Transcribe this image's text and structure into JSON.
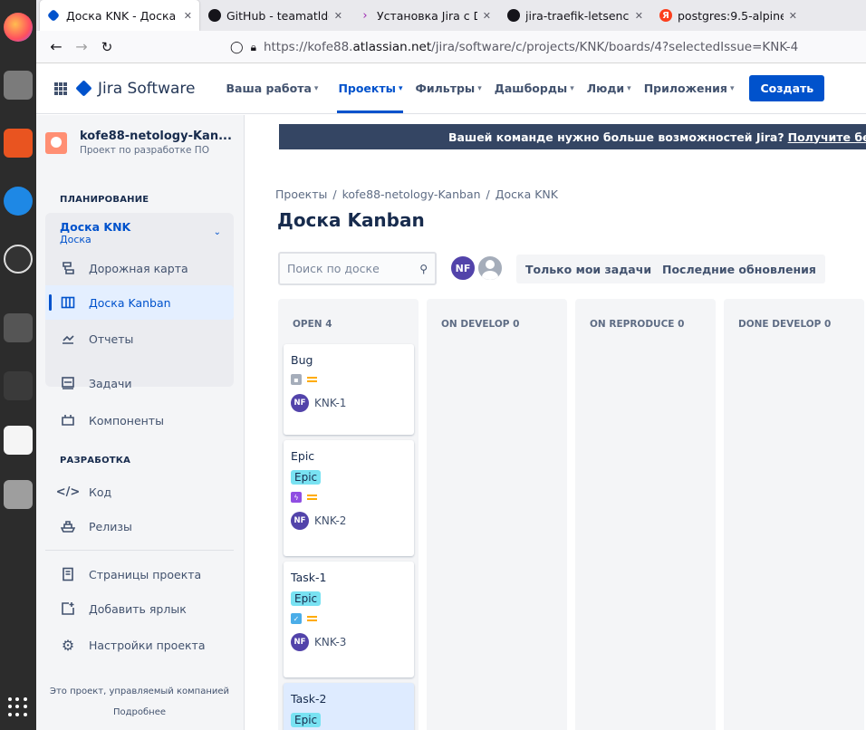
{
  "browser": {
    "tabs": [
      {
        "title": "Доска KNK - Доска |",
        "favicon": "jira-icon",
        "active": true
      },
      {
        "title": "GitHub - teamatldoc",
        "favicon": "github-icon",
        "active": false
      },
      {
        "title": "Установка Jira с Doc",
        "favicon": "chevron-icon",
        "active": false
      },
      {
        "title": "jira-traefik-letsencry",
        "favicon": "github-icon",
        "active": false
      },
      {
        "title": "postgres:9.5-alpine -",
        "favicon": "yandex-icon",
        "active": false
      }
    ],
    "url_prefix": "https://kofe88.",
    "url_domain": "atlassian.net",
    "url_path": "/jira/software/c/projects/KNK/boards/4?selectedIssue=KNK-4"
  },
  "topnav": {
    "product": "Jira Software",
    "menu": [
      "Ваша работа",
      "Проекты",
      "Фильтры",
      "Дашборды",
      "Люди",
      "Приложения"
    ],
    "create": "Создать"
  },
  "sidebar": {
    "project_name": "kofe88-netology-Kan...",
    "project_type": "Проект по разработке ПО",
    "planning_title": "ПЛАНИРОВАНИЕ",
    "board_name": "Доска KNK",
    "board_sub": "Доска",
    "board_items": [
      "Дорожная карта",
      "Доска Kanban",
      "Отчеты"
    ],
    "items": [
      "Задачи",
      "Компоненты"
    ],
    "dev_title": "РАЗРАБОТКА",
    "dev_items": [
      "Код",
      "Релизы"
    ],
    "settings_items": [
      "Страницы проекта",
      "Добавить ярлык",
      "Настройки проекта"
    ],
    "footer_text": "Это проект, управляемый компанией",
    "footer_link": "Подробнее"
  },
  "main": {
    "banner_text": "Вашей команде нужно больше возможностей Jira?",
    "banner_link": "Получите бес",
    "breadcrumbs": [
      "Проекты",
      "kofe88-netology-Kanban",
      "Доска KNK"
    ],
    "title": "Доска Kanban",
    "search_placeholder": "Поиск по доске",
    "user_initials": "NF",
    "quick_filters": [
      "Только мои задачи",
      "Последние обновления"
    ],
    "columns": [
      "OPEN 4",
      "ON DEVELOP 0",
      "ON REPRODUCE 0",
      "DONE DEVELOP 0"
    ],
    "cards": [
      {
        "summary": "Bug",
        "epic": "",
        "key": "KNK-1"
      },
      {
        "summary": "Epic",
        "epic": "Epic",
        "key": "KNK-2"
      },
      {
        "summary": "Task-1",
        "epic": "Epic",
        "key": "KNK-3"
      },
      {
        "summary": "Task-2",
        "epic": "Epic",
        "key": ""
      }
    ]
  },
  "colors": {
    "primary": "#0052cc",
    "banner": "#344563",
    "epic": "#79e2f2",
    "priority": "#ffab00"
  }
}
